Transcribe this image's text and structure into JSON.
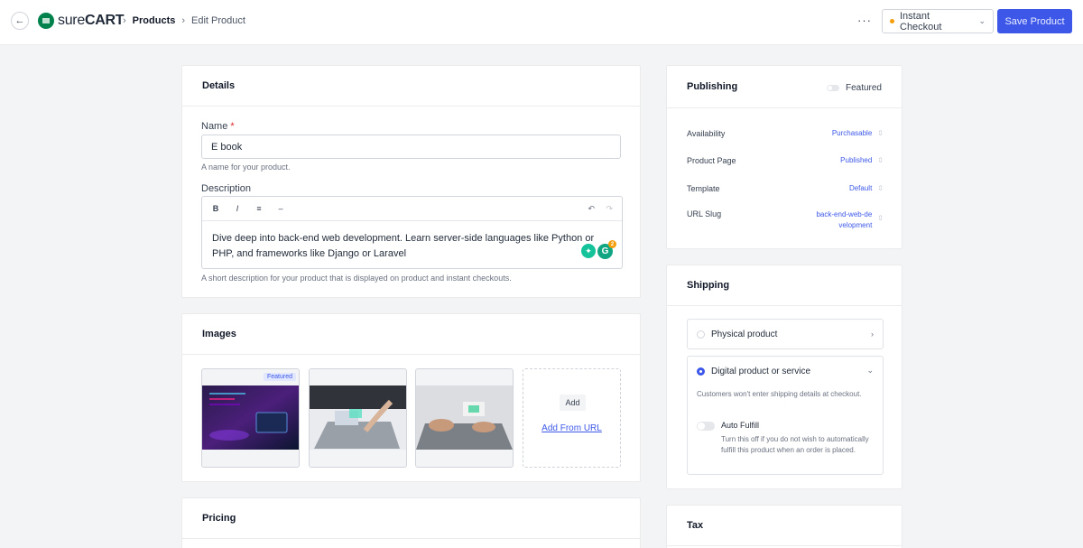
{
  "header": {
    "back_icon": "arrow-left-icon",
    "logo_text_sure": "sure",
    "logo_text_cart": "CART",
    "breadcrumb": [
      "Products",
      "Edit Product"
    ],
    "more_label": "···",
    "checkout_select": "Instant Checkout",
    "save_label": "Save Product",
    "accent_color": "#3d58e8"
  },
  "details": {
    "title": "Details",
    "name_label": "Name",
    "name_required": "*",
    "name_value": "E book",
    "name_hint": "A name for your product.",
    "description_label": "Description",
    "toolbar": {
      "bold": "B",
      "italic": "I",
      "list": "≡",
      "dash": "–",
      "undo": "↶",
      "redo": "↷"
    },
    "description_text": "Dive deep into back-end web development. Learn server-side languages like Python or PHP, and frameworks like Django or Laravel",
    "description_hint": "A short description for your product that is displayed on product and instant checkouts.",
    "grammarly_count": "2"
  },
  "images": {
    "title": "Images",
    "featured_badge": "Featured",
    "add_label": "Add",
    "add_url_label": "Add From URL"
  },
  "pricing": {
    "title": "Pricing"
  },
  "publishing": {
    "title": "Publishing",
    "featured_label": "Featured",
    "rows": [
      {
        "label": "Availability",
        "value": "Purchasable"
      },
      {
        "label": "Product Page",
        "value": "Published"
      },
      {
        "label": "Template",
        "value": "Default"
      },
      {
        "label": "URL Slug",
        "value": "back-end-web-development"
      }
    ]
  },
  "shipping": {
    "title": "Shipping",
    "physical_label": "Physical product",
    "digital_label": "Digital product or service",
    "digital_note": "Customers won't enter shipping details at checkout.",
    "auto_fulfill_label": "Auto Fulfill",
    "auto_fulfill_desc": "Turn this off if you do not wish to automatically fulfill this product when an order is placed."
  },
  "tax": {
    "title": "Tax"
  }
}
